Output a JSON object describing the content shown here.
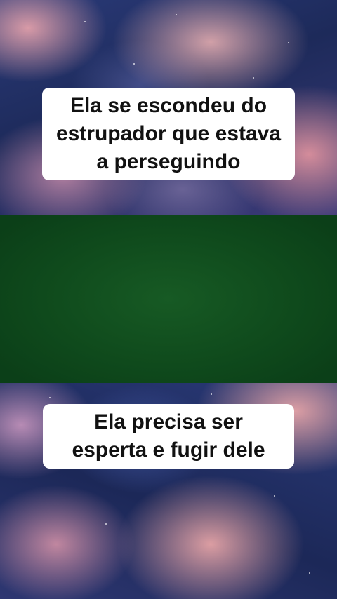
{
  "video": {
    "captions": [
      "Ela se escondeu do\nestrupador que estava\na perseguindo",
      "Ela precisa ser\nesperta e fugir dele"
    ],
    "colors": {
      "green_panel": "#0f4a1c",
      "caption_background": "#ffffff",
      "caption_text": "#111111"
    }
  }
}
